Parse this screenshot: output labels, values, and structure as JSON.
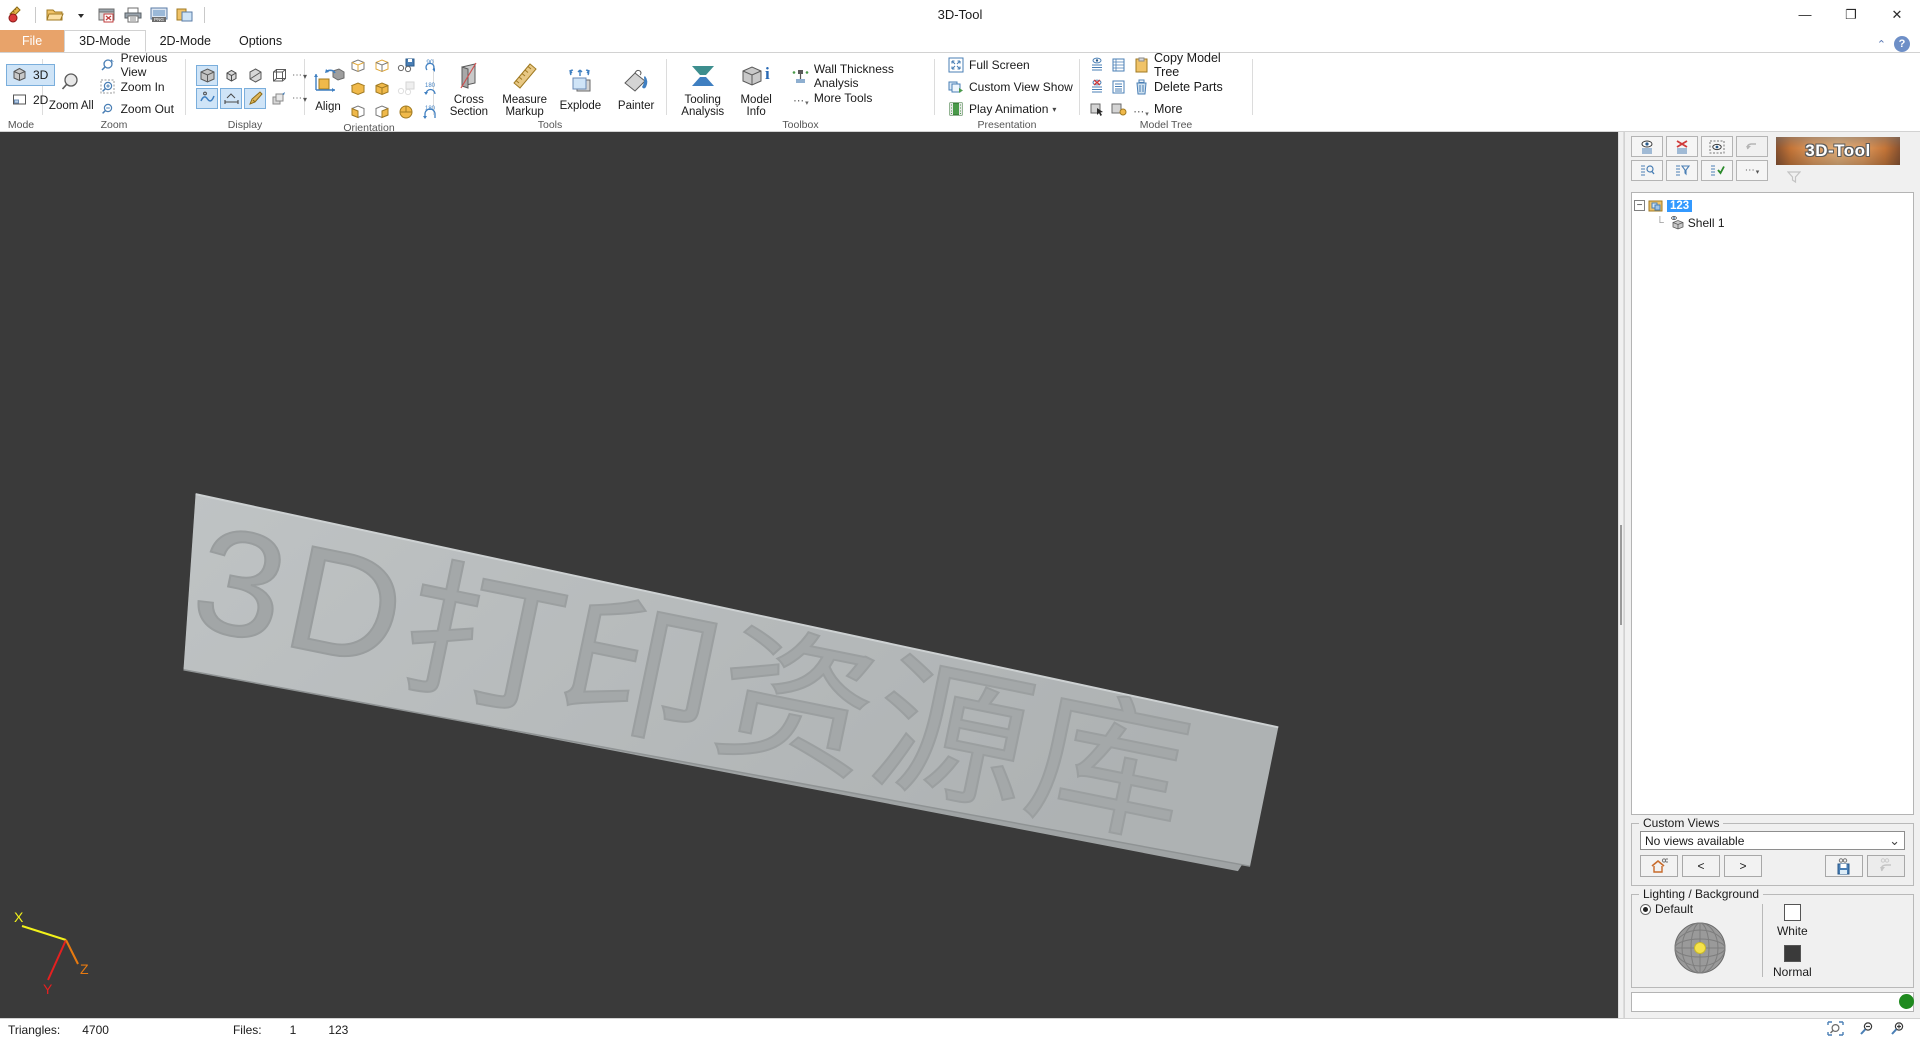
{
  "window": {
    "title": "3D-Tool",
    "minimize": "—",
    "maximize": "❐",
    "close": "✕"
  },
  "quick_access": {
    "items": [
      {
        "name": "new-measure-icon",
        "label": "New"
      },
      {
        "name": "open-file-icon",
        "label": "Open"
      },
      {
        "name": "open-dropdown-icon",
        "label": "Open recent"
      },
      {
        "name": "close-file-icon",
        "label": "Close"
      },
      {
        "name": "print-icon",
        "label": "Print"
      },
      {
        "name": "export-png-icon",
        "label": "Export PNG"
      },
      {
        "name": "copy-clipboard-icon",
        "label": "Copy"
      }
    ]
  },
  "tabs": [
    {
      "label": "File",
      "type": "file"
    },
    {
      "label": "3D-Mode",
      "type": "active"
    },
    {
      "label": "2D-Mode",
      "type": "normal"
    },
    {
      "label": "Options",
      "type": "normal"
    }
  ],
  "ribbon": {
    "collapse_icon": "⌃",
    "help_icon": "?",
    "groups": [
      {
        "name": "mode",
        "label": "Mode",
        "items": [
          {
            "label": "3D",
            "selected": true
          },
          {
            "label": "2D",
            "selected": false
          }
        ]
      },
      {
        "name": "zoom",
        "label": "Zoom",
        "big": {
          "label": "Zoom All"
        },
        "items": [
          {
            "label": "Previous View"
          },
          {
            "label": "Zoom In"
          },
          {
            "label": "Zoom Out"
          }
        ]
      },
      {
        "name": "display",
        "label": "Display",
        "more": "⋯"
      },
      {
        "name": "orientation",
        "label": "Orientation",
        "big": {
          "label": "Align"
        },
        "rot": [
          "90",
          "180",
          "180"
        ]
      },
      {
        "name": "tools",
        "label": "Tools",
        "items": [
          {
            "label": "Cross Section"
          },
          {
            "label": "Measure Markup"
          },
          {
            "label": "Explode"
          },
          {
            "label": "Painter"
          }
        ]
      },
      {
        "name": "toolbox",
        "label": "Toolbox",
        "items": [
          {
            "label": "Tooling Analysis"
          },
          {
            "label": "Model Info"
          }
        ],
        "small_items": [
          {
            "label": "Wall Thickness Analysis"
          },
          {
            "label": "More Tools"
          }
        ]
      },
      {
        "name": "presentation",
        "label": "Presentation",
        "small_items": [
          {
            "label": "Full Screen"
          },
          {
            "label": "Custom View Show"
          },
          {
            "label": "Play Animation"
          }
        ]
      },
      {
        "name": "model-tree",
        "label": "Model Tree",
        "small_items": [
          {
            "label": "Copy Model Tree"
          },
          {
            "label": "Delete Parts"
          },
          {
            "label": "More"
          }
        ]
      }
    ]
  },
  "viewport": {
    "background_color": "#3a3a3a",
    "plate_color": "#b8bcbd",
    "engraved_text": "3D打印资源库",
    "axis": {
      "x_label": "X",
      "y_label": "Y",
      "z_label": "Z",
      "x_color": "#f2f21a",
      "y_color": "#e52020",
      "z_color": "#e87a10"
    }
  },
  "right_panel": {
    "logo_text": "3D-Tool",
    "toolbar_row1": [
      {
        "name": "show-all-icon"
      },
      {
        "name": "hide-selected-icon"
      },
      {
        "name": "show-selected-icon"
      },
      {
        "name": "undo-visibility-icon",
        "disabled": true
      }
    ],
    "toolbar_row2": [
      {
        "name": "find-part-icon"
      },
      {
        "name": "filter-tree-icon"
      },
      {
        "name": "check-tree-icon"
      },
      {
        "name": "tree-more-icon"
      }
    ],
    "toolbar_extra": {
      "name": "clear-filter-icon",
      "disabled": true
    },
    "tree": {
      "root": {
        "label": "123",
        "selected": true,
        "expander": "−"
      },
      "children": [
        {
          "label": "Shell 1"
        }
      ]
    },
    "custom_views": {
      "caption": "Custom Views",
      "selected": "No views available",
      "dropdown_icon": "⌄",
      "buttons": [
        {
          "name": "home-view-button",
          "label": ""
        },
        {
          "name": "previous-view-button",
          "label": "<"
        },
        {
          "name": "next-view-button",
          "label": ">"
        },
        {
          "name": "save-view-button",
          "label": ""
        },
        {
          "name": "undo-view-button",
          "label": "",
          "disabled": true
        }
      ]
    },
    "lighting": {
      "caption": "Lighting / Background",
      "default_label": "Default",
      "default_selected": true,
      "background_white_label": "White",
      "background_normal_label": "Normal"
    }
  },
  "status_bar": {
    "triangles_label": "Triangles:",
    "triangles_value": "4700",
    "files_label": "Files:",
    "files_value": "1",
    "file_name": "123",
    "zoom_icons": [
      {
        "name": "zoom-all-icon"
      },
      {
        "name": "zoom-out-icon"
      },
      {
        "name": "zoom-in-icon"
      }
    ]
  }
}
